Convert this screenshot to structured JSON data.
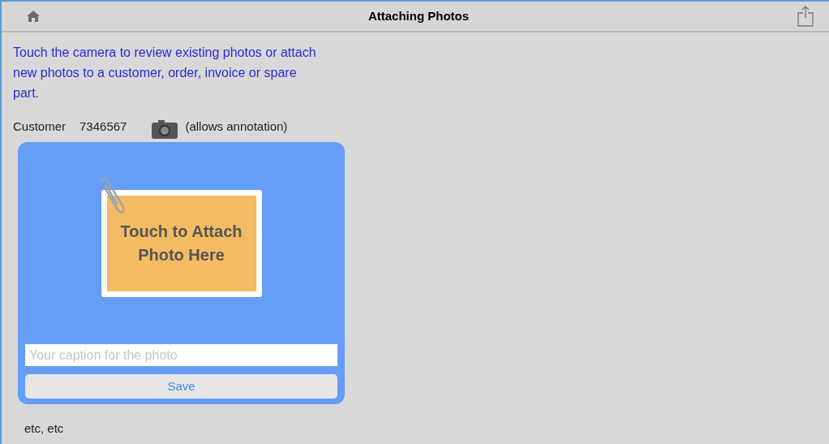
{
  "nav_bar": {
    "title": "Attaching Photos"
  },
  "intro": "Touch the camera to review existing photos or attach new photos to a customer, order, invoice or spare part.",
  "customer_row": {
    "label": "Customer",
    "number": "7346567",
    "note": "(allows annotation)"
  },
  "popover": {
    "attach_prompt": "Touch to Attach Photo Here",
    "caption": {
      "placeholder": "Your caption for the photo"
    },
    "save_button": "Save"
  },
  "etc_lines": [
    "etc, etc"
  ]
}
